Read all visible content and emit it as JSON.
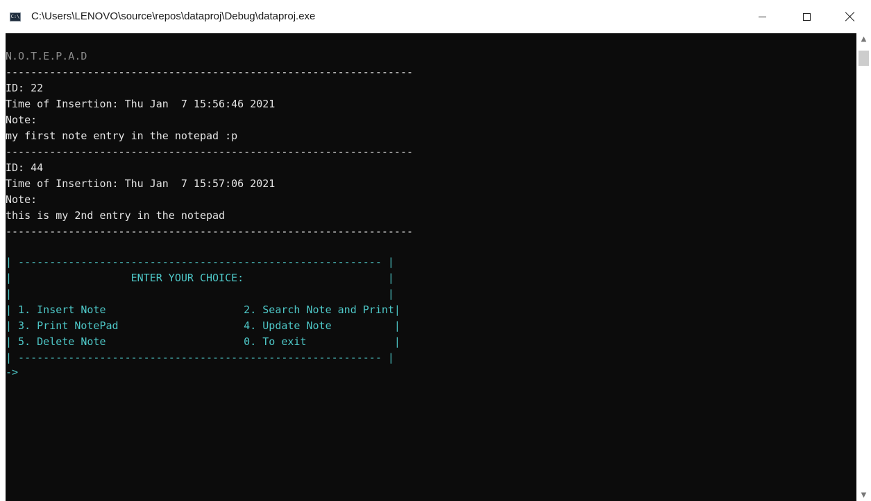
{
  "window": {
    "title": "C:\\Users\\LENOVO\\source\\repos\\dataproj\\Debug\\dataproj.exe",
    "icon_text": "C:\\"
  },
  "console": {
    "header": "N.O.T.E.P.A.D",
    "separator": "-----------------------------------------------------------------",
    "notes": [
      {
        "id_line": "ID: 22",
        "time_line": "Time of Insertion: Thu Jan  7 15:56:46 2021",
        "note_label": "Note:",
        "note_text": "my first note entry in the notepad :p"
      },
      {
        "id_line": "ID: 44",
        "time_line": "Time of Insertion: Thu Jan  7 15:57:06 2021",
        "note_label": "Note:",
        "note_text": "this is my 2nd entry in the notepad"
      }
    ],
    "menu": {
      "top_border": "| ---------------------------------------------------------- |",
      "blank_line": "|                                                            |",
      "title_line": "|                   ENTER YOUR CHOICE:                       |",
      "row1": "| 1. Insert Note                      2. Search Note and Print|",
      "row2": "| 3. Print NotePad                    4. Update Note          |",
      "row3": "| 5. Delete Note                      0. To exit              |",
      "bottom_border": "| ---------------------------------------------------------- |"
    },
    "prompt": "->"
  },
  "colors": {
    "background": "#0c0c0c",
    "text": "#e4e4e4",
    "header": "#8c8c8c",
    "menu": "#4ec8c8"
  },
  "icons": [
    "console-app-icon",
    "minimize-icon",
    "maximize-icon",
    "close-icon",
    "scroll-up-arrow-icon",
    "scroll-down-arrow-icon"
  ]
}
